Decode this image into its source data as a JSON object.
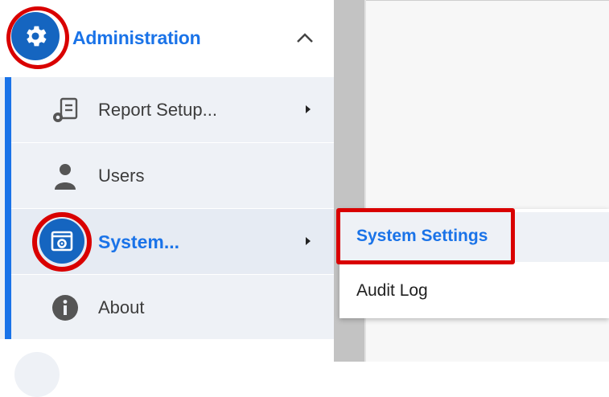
{
  "sidebar": {
    "section": {
      "title": "Administration",
      "icon": "gear-icon",
      "expanded_icon": "chevron-up-icon"
    },
    "items": [
      {
        "label": "Report Setup...",
        "icon": "report-settings-icon",
        "has_submenu": true
      },
      {
        "label": "Users",
        "icon": "user-icon",
        "has_submenu": false
      },
      {
        "label": "System...",
        "icon": "system-settings-icon",
        "has_submenu": true,
        "active": true
      },
      {
        "label": "About",
        "icon": "info-icon",
        "has_submenu": false
      }
    ]
  },
  "flyout": {
    "items": [
      {
        "label": "System Settings",
        "highlighted": true
      },
      {
        "label": "Audit Log",
        "highlighted": false
      }
    ]
  },
  "colors": {
    "accent": "#1a73e8",
    "icon_circle": "#1565c0",
    "annotation_red": "#d90000",
    "submenu_bg": "#eef1f6",
    "gutter": "#c3c3c3"
  }
}
